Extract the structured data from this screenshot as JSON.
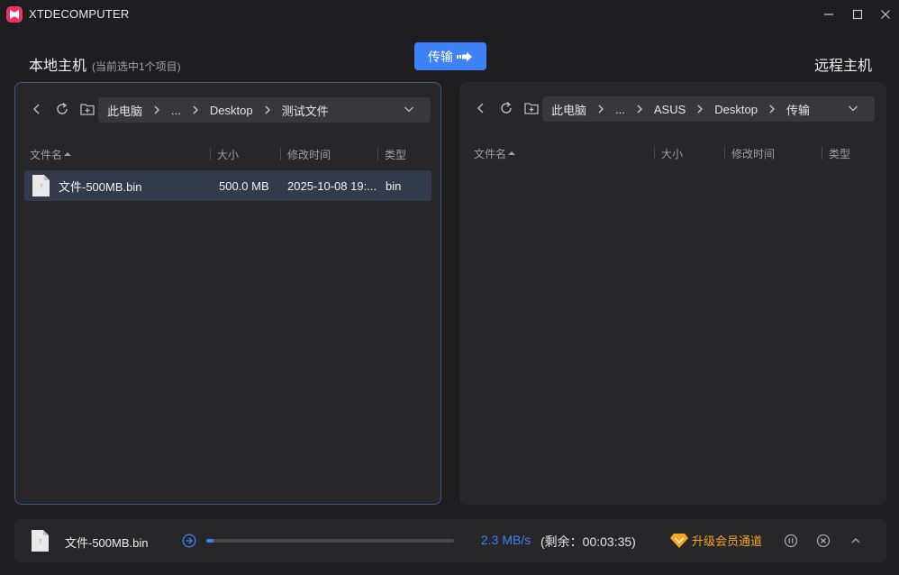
{
  "window": {
    "title": "XTDECOMPUTER",
    "minimize_icon": "minimize-icon",
    "maximize_icon": "maximize-icon",
    "close_icon": "close-icon"
  },
  "local": {
    "title": "本地主机",
    "selection_note": "(当前选中1个项目)",
    "path": [
      "此电脑",
      "...",
      "Desktop",
      "测试文件"
    ],
    "columns": [
      "文件名",
      "大小",
      "修改时间",
      "类型"
    ],
    "files": [
      {
        "name": "文件-500MB.bin",
        "size": "500.0 MB",
        "modified": "2025-10-08 19:...",
        "type": "bin"
      }
    ]
  },
  "remote": {
    "title": "远程主机",
    "path": [
      "此电脑",
      "...",
      "ASUS",
      "Desktop",
      "传输"
    ],
    "columns": [
      "文件名",
      "大小",
      "修改时间",
      "类型"
    ],
    "files": []
  },
  "transfer_button": {
    "label": "传输"
  },
  "transfer": {
    "file_name": "文件-500MB.bin",
    "progress": 0.03,
    "speed": "2.3 MB/s",
    "remaining": "(剩余：00:03:35)",
    "upgrade_label": "升级会员通道"
  },
  "colors": {
    "accent": "#3d82f7",
    "brand": "#e8365a",
    "upgrade": "#f5a623",
    "background": "#1e1e20",
    "panel": "#272729"
  }
}
